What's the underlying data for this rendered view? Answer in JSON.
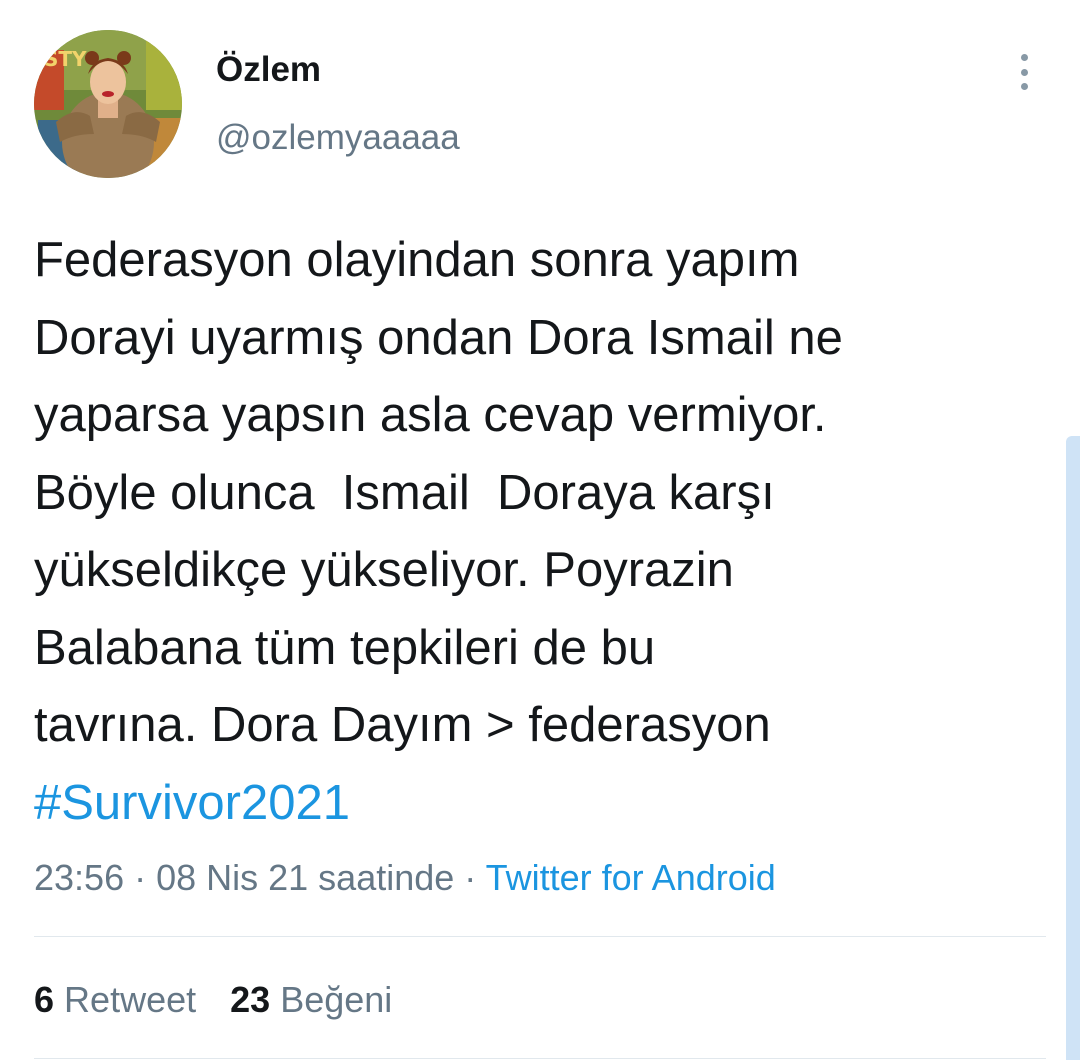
{
  "author": {
    "display_name": "Özlem",
    "handle": "@ozlemyaaaaa",
    "avatar_icon": "profile-photo"
  },
  "tweet": {
    "lines": [
      "Federasyon olayindan sonra yapım",
      "Dorayi uyarmış ondan Dora Ismail ne",
      "yaparsa yapsın asla cevap vermiyor.",
      "Böyle olunca  Ismail  Doraya karşı",
      "yükseldikçe yükseliyor. Poyrazin",
      "Balabana tüm tepkileri de bu",
      "tavrına. Dora Dayım > federasyon"
    ],
    "hashtag": "#Survivor2021"
  },
  "meta": {
    "time": "23:56",
    "date": "08 Nis 21 saatinde",
    "separator": " · ",
    "source": "Twitter for Android"
  },
  "stats": {
    "retweet_count": "6",
    "retweet_label": "Retweet",
    "like_count": "23",
    "like_label": "Beğeni"
  },
  "colors": {
    "link": "#1b95e0",
    "secondary_text": "#657786",
    "primary_text": "#14171a",
    "divider": "#e1e8ed"
  },
  "icons": {
    "more": "more-vertical-icon"
  }
}
